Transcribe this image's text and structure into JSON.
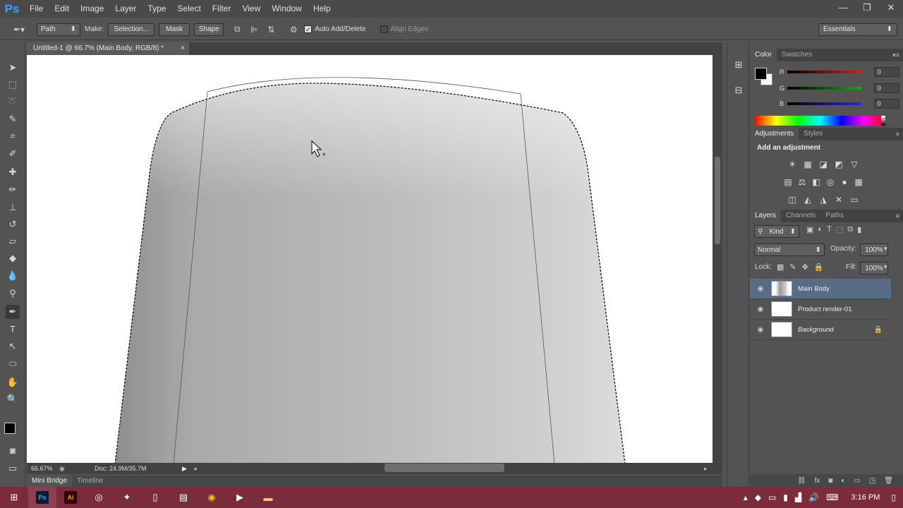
{
  "app": {
    "logo": "Ps"
  },
  "menu": [
    "File",
    "Edit",
    "Image",
    "Layer",
    "Type",
    "Select",
    "Filter",
    "View",
    "Window",
    "Help"
  ],
  "window_controls": {
    "minimize": "—",
    "restore": "❐",
    "close": "✕"
  },
  "options_bar": {
    "mode": "Path",
    "make_label": "Make:",
    "selection_btn": "Selection...",
    "mask_btn": "Mask",
    "shape_btn": "Shape",
    "auto_add_delete": "Auto Add/Delete",
    "align_edges": "Align Edges",
    "workspace": "Essentials"
  },
  "document": {
    "tab_title": "Untitled-1 @ 66.7% (Main Body, RGB/8) *",
    "close": "×",
    "zoom": "66.67%",
    "doc_info": "Doc: 24.9M/35.7M"
  },
  "bottom_tabs": [
    "Mini Bridge",
    "Timeline"
  ],
  "color_panel": {
    "tabs": [
      "Color",
      "Swatches"
    ],
    "channels": [
      {
        "label": "R",
        "value": "0",
        "color": "#d42020"
      },
      {
        "label": "G",
        "value": "0",
        "color": "#1fa21f"
      },
      {
        "label": "B",
        "value": "0",
        "color": "#2a2ad4"
      }
    ]
  },
  "adjustments_panel": {
    "tabs": [
      "Adjustments",
      "Styles"
    ],
    "heading": "Add an adjustment"
  },
  "layers_panel": {
    "tabs": [
      "Layers",
      "Channels",
      "Paths"
    ],
    "filter_kind": "Kind",
    "blend_mode": "Normal",
    "opacity_label": "Opacity:",
    "opacity": "100%",
    "lock_label": "Lock:",
    "fill_label": "Fill:",
    "fill": "100%",
    "layers": [
      {
        "name": "Main Body",
        "selected": true
      },
      {
        "name": "Product render-01",
        "selected": false
      },
      {
        "name": "Background",
        "selected": false
      }
    ]
  },
  "taskbar": {
    "time": "3:16 PM"
  }
}
